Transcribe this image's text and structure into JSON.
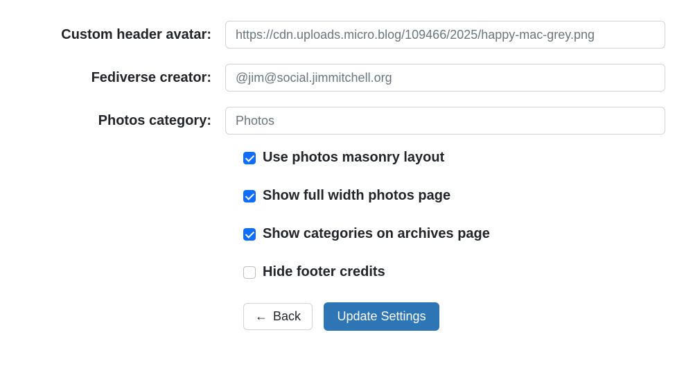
{
  "fields": {
    "custom_header_avatar": {
      "label": "Custom header avatar:",
      "value": "https://cdn.uploads.micro.blog/109466/2025/happy-mac-grey.png"
    },
    "fediverse_creator": {
      "label": "Fediverse creator:",
      "value": "@jim@social.jimmitchell.org"
    },
    "photos_category": {
      "label": "Photos category:",
      "value": "Photos"
    }
  },
  "checkboxes": {
    "masonry": {
      "label": "Use photos masonry layout",
      "checked": true
    },
    "full_width": {
      "label": "Show full width photos page",
      "checked": true
    },
    "categories_archives": {
      "label": "Show categories on archives page",
      "checked": true
    },
    "hide_footer": {
      "label": "Hide footer credits",
      "checked": false
    }
  },
  "buttons": {
    "back": "Back",
    "update": "Update Settings"
  }
}
